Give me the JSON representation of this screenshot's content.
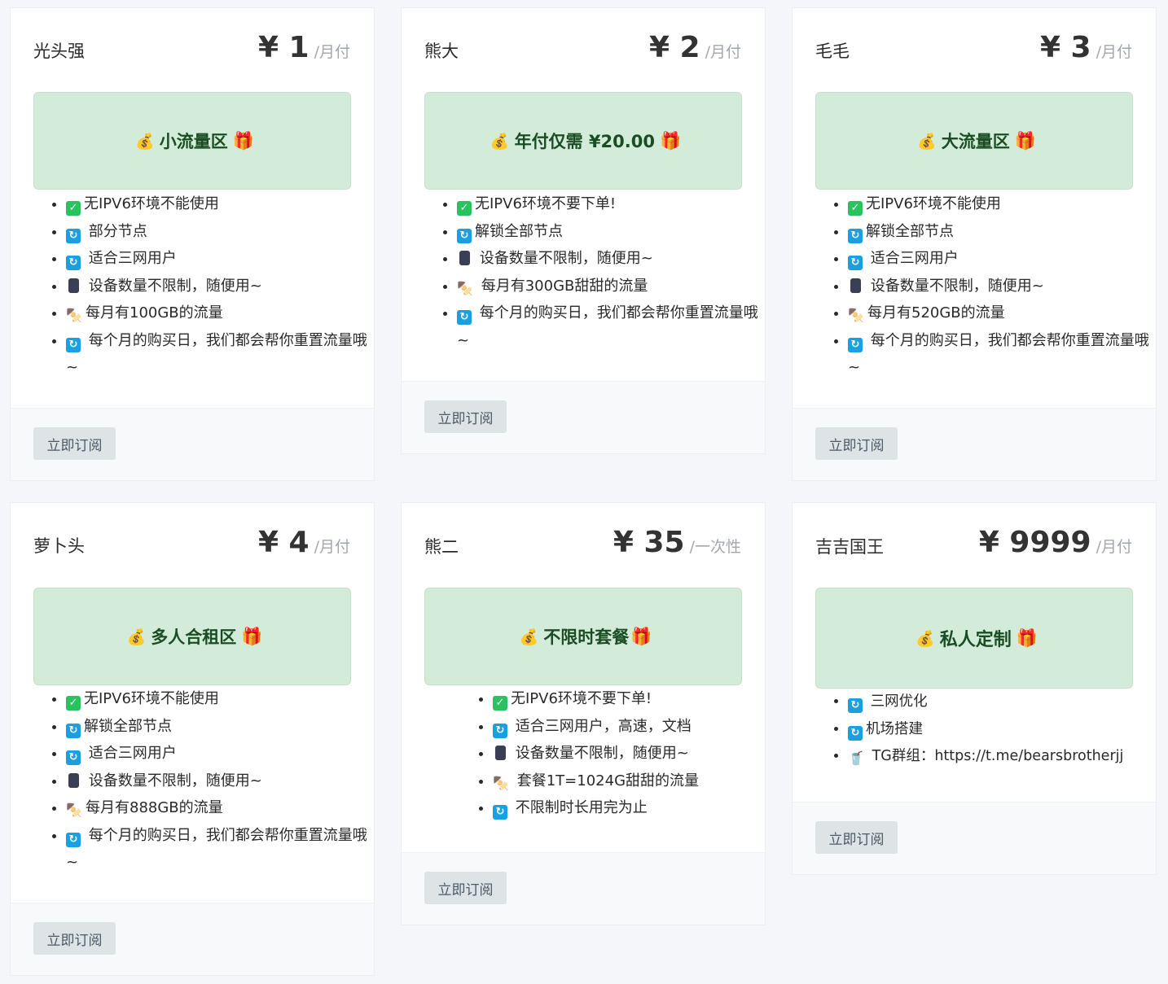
{
  "plans": [
    {
      "name": "光头强",
      "price": "¥ 1",
      "period": "/月付",
      "banner": "小流量区",
      "features": [
        {
          "icon": "check",
          "text": "无IPV6环境不能使用"
        },
        {
          "icon": "refresh",
          "text": "部分节点"
        },
        {
          "icon": "refresh",
          "text": "适合三网用户"
        },
        {
          "icon": "phone",
          "text": "设备数量不限制，随便用~"
        },
        {
          "icon": "food",
          "text": "每月有100GB的流量"
        },
        {
          "icon": "refresh",
          "text": "每个月的购买日，我们都会帮你重置流量哦~"
        }
      ],
      "button": "立即订阅"
    },
    {
      "name": "熊大",
      "price": "¥ 2",
      "period": "/月付",
      "banner": "年付仅需 ¥20.00",
      "features": [
        {
          "icon": "check",
          "text": "无IPV6环境不要下单!"
        },
        {
          "icon": "refresh",
          "text": "解锁全部节点"
        },
        {
          "icon": "phone",
          "text": "设备数量不限制，随便用~"
        },
        {
          "icon": "food",
          "text": "每月有300GB甜甜的流量"
        },
        {
          "icon": "refresh",
          "text": "每个月的购买日，我们都会帮你重置流量哦~"
        }
      ],
      "button": "立即订阅"
    },
    {
      "name": "毛毛",
      "price": "¥ 3",
      "period": "/月付",
      "banner": "大流量区",
      "features": [
        {
          "icon": "check",
          "text": "无IPV6环境不能使用"
        },
        {
          "icon": "refresh",
          "text": "解锁全部节点"
        },
        {
          "icon": "refresh",
          "text": "适合三网用户"
        },
        {
          "icon": "phone",
          "text": "设备数量不限制，随便用~"
        },
        {
          "icon": "food",
          "text": "每月有520GB的流量"
        },
        {
          "icon": "refresh",
          "text": "每个月的购买日，我们都会帮你重置流量哦~"
        }
      ],
      "button": "立即订阅"
    },
    {
      "name": "萝卜头",
      "price": "¥ 4",
      "period": "/月付",
      "banner": "多人合租区",
      "features": [
        {
          "icon": "check",
          "text": "无IPV6环境不能使用"
        },
        {
          "icon": "refresh",
          "text": "解锁全部节点"
        },
        {
          "icon": "refresh",
          "text": "适合三网用户"
        },
        {
          "icon": "phone",
          "text": "设备数量不限制，随便用~"
        },
        {
          "icon": "food",
          "text": "每月有888GB的流量"
        },
        {
          "icon": "refresh",
          "text": "每个月的购买日，我们都会帮你重置流量哦~"
        }
      ],
      "button": "立即订阅"
    },
    {
      "name": "熊二",
      "price": "¥ 35",
      "period": "/一次性",
      "banner": "不限时套餐",
      "features": [
        {
          "icon": "check",
          "text": "无IPV6环境不要下单!"
        },
        {
          "icon": "refresh",
          "text": "适合三网用户，高速，文档"
        },
        {
          "icon": "phone",
          "text": "设备数量不限制，随便用~"
        },
        {
          "icon": "food",
          "text": "套餐1T=1024G甜甜的流量"
        },
        {
          "icon": "refresh",
          "text": "不限制时长用完为止"
        }
      ],
      "button": "立即订阅"
    },
    {
      "name": "吉吉国王",
      "price": "¥ 9999",
      "period": "/月付",
      "banner": "私人定制",
      "features": [
        {
          "icon": "refresh",
          "text": "三网优化"
        },
        {
          "icon": "refresh",
          "text": "机场搭建"
        },
        {
          "icon": "drink",
          "text": "TG群组：https://t.me/bearsbrotherjj"
        }
      ],
      "button": "立即订阅"
    }
  ],
  "colors": {
    "banner_bg": "#d3ecd9",
    "banner_text": "#1b4d24",
    "button_bg": "#dee3e6",
    "page_bg": "#f4f6f9"
  }
}
